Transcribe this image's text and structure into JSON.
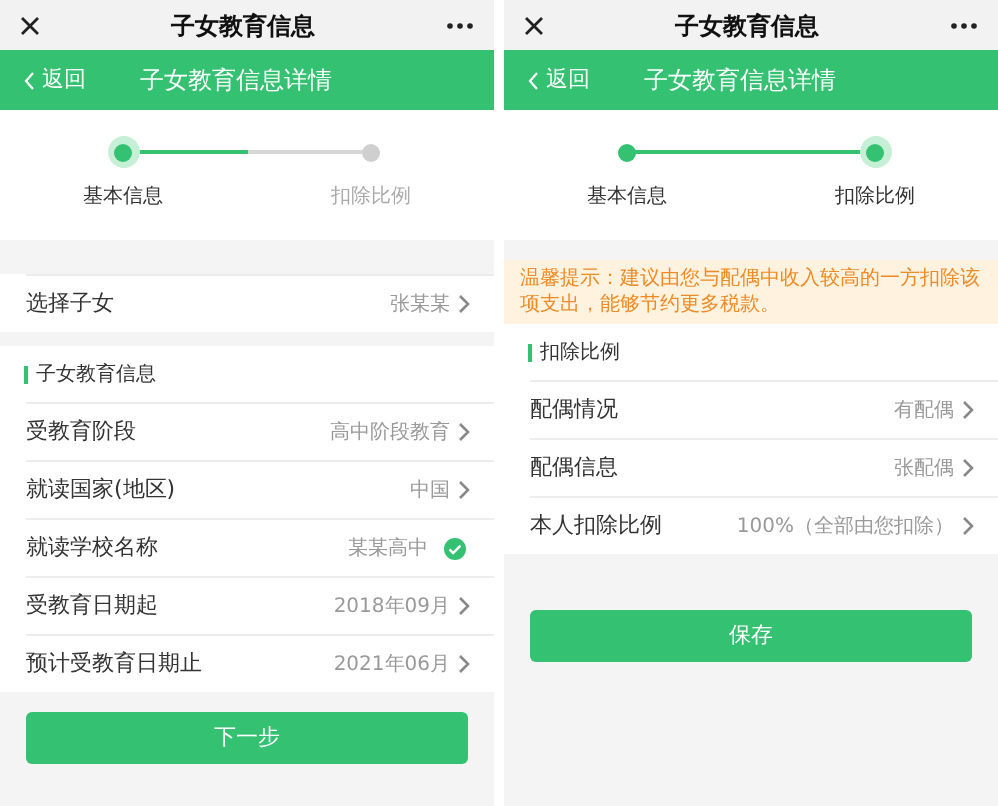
{
  "screens": [
    {
      "top_bar": {
        "title": "子女教育信息"
      },
      "nav": {
        "back": "返回",
        "title": "子女教育信息详情"
      },
      "steps": [
        {
          "label": "基本信息",
          "selected": true,
          "completed": false
        },
        {
          "label": "扣除比例",
          "selected": false,
          "completed": false
        }
      ],
      "groups": [
        {
          "rows": [
            {
              "label": "选择子女",
              "value": "张某某",
              "kind": "arrow"
            }
          ]
        },
        {
          "header": "子女教育信息",
          "rows": [
            {
              "label": "受教育阶段",
              "value": "高中阶段教育",
              "kind": "arrow"
            },
            {
              "label": "就读国家(地区)",
              "value": "中国",
              "kind": "arrow"
            },
            {
              "label": "就读学校名称",
              "value": "某某高中",
              "kind": "check"
            },
            {
              "label": "受教育日期起",
              "value": "2018年09月",
              "kind": "arrow"
            },
            {
              "label": "预计受教育日期止",
              "value": "2021年06月",
              "kind": "arrow"
            }
          ]
        }
      ],
      "button": "下一步"
    },
    {
      "top_bar": {
        "title": "子女教育信息"
      },
      "nav": {
        "back": "返回",
        "title": "子女教育信息详情"
      },
      "steps": [
        {
          "label": "基本信息",
          "selected": false,
          "completed": true
        },
        {
          "label": "扣除比例",
          "selected": true,
          "completed": false
        }
      ],
      "notice": "温馨提示：建议由您与配偶中收入较高的一方扣除该项支出，能够节约更多税款。",
      "groups": [
        {
          "header": "扣除比例",
          "rows": [
            {
              "label": "配偶情况",
              "value": "有配偶",
              "kind": "arrow"
            },
            {
              "label": "配偶信息",
              "value": "张配偶",
              "kind": "arrow"
            },
            {
              "label": "本人扣除比例",
              "value": "100%（全部由您扣除）",
              "kind": "arrow"
            }
          ]
        }
      ],
      "button": "保存"
    }
  ]
}
